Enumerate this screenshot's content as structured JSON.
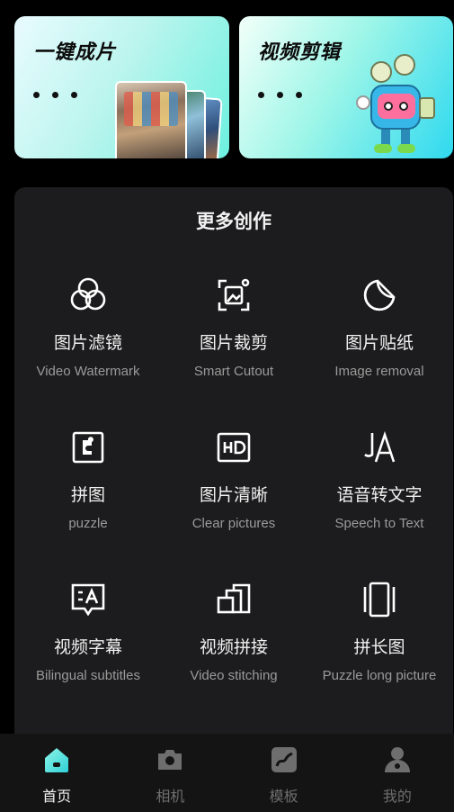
{
  "banners": {
    "left": {
      "title": "一键成片"
    },
    "right": {
      "title": "视频剪辑"
    }
  },
  "section": {
    "title": "更多创作"
  },
  "tools": [
    {
      "zh": "图片滤镜",
      "en": "Video Watermark",
      "icon": "filter-circles-icon"
    },
    {
      "zh": "图片裁剪",
      "en": "Smart Cutout",
      "icon": "crop-image-icon"
    },
    {
      "zh": "图片贴纸",
      "en": "Image removal",
      "icon": "sticker-icon"
    },
    {
      "zh": "拼图",
      "en": "puzzle",
      "icon": "puzzle-piece-icon"
    },
    {
      "zh": "图片清晰",
      "en": "Clear pictures",
      "icon": "hd-icon"
    },
    {
      "zh": "语音转文字",
      "en": "Speech to Text",
      "icon": "speech-to-text-icon"
    },
    {
      "zh": "视频字幕",
      "en": "Bilingual subtitles",
      "icon": "subtitle-icon"
    },
    {
      "zh": "视频拼接",
      "en": "Video stitching",
      "icon": "video-stitch-icon"
    },
    {
      "zh": "拼长图",
      "en": "Puzzle long picture",
      "icon": "long-picture-icon"
    }
  ],
  "tabbar": {
    "items": [
      {
        "label": "首页",
        "icon": "home-icon",
        "active": true
      },
      {
        "label": "相机",
        "icon": "camera-icon",
        "active": false
      },
      {
        "label": "模板",
        "icon": "template-icon",
        "active": false
      },
      {
        "label": "我的",
        "icon": "profile-icon",
        "active": false
      }
    ]
  },
  "colors": {
    "background": "#000000",
    "panel": "#1c1c1e",
    "tabbar": "#141414",
    "active_accent": "#4ee8d8",
    "inactive": "#6e6e6e"
  }
}
